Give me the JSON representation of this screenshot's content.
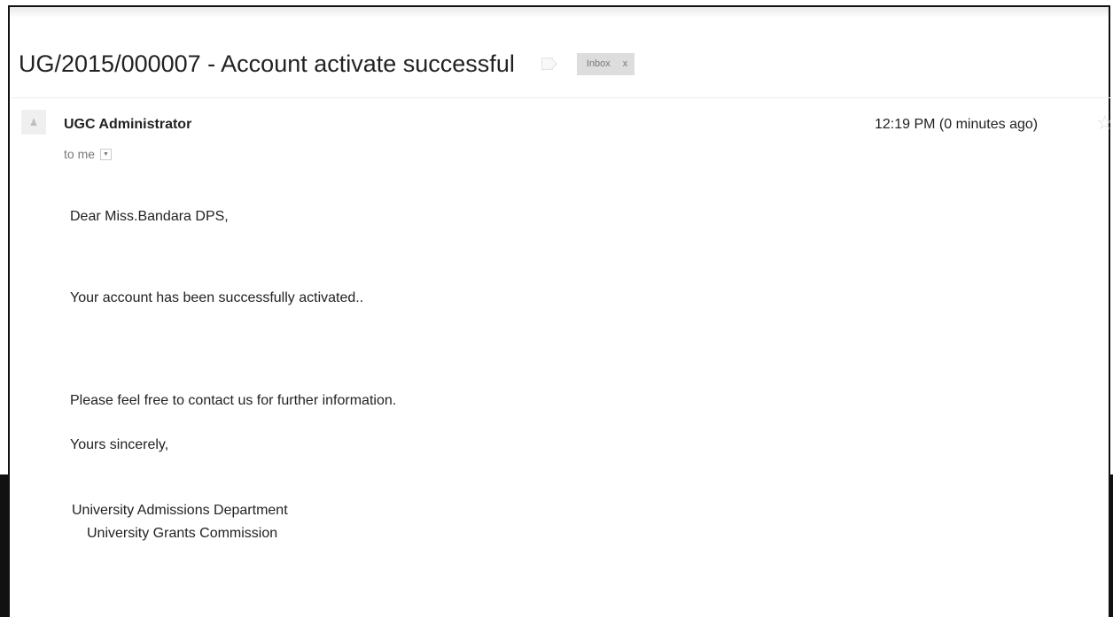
{
  "email": {
    "subject": "UG/2015/000007 - Account activate successful",
    "label_chip": {
      "text": "Inbox",
      "remove": "x"
    },
    "sender": "UGC Administrator",
    "recipient": "to me",
    "timestamp": "12:19 PM (0 minutes ago)",
    "body": {
      "greeting": "Dear Miss.Bandara DPS,",
      "line1": "Your account has been successfully activated..",
      "line2": "Please feel free to contact us for further information.",
      "closing": "Yours sincerely,",
      "signature_line1": "University Admissions Department",
      "signature_line2": "University Grants Commission"
    }
  },
  "icons": {
    "label": "label-icon",
    "avatar": "person-icon",
    "recipient_dropdown": "chevron-down-icon",
    "star": "star-icon"
  },
  "colors": {
    "chip_background": "#dddddd",
    "muted_text": "#777777",
    "text": "#222222"
  }
}
